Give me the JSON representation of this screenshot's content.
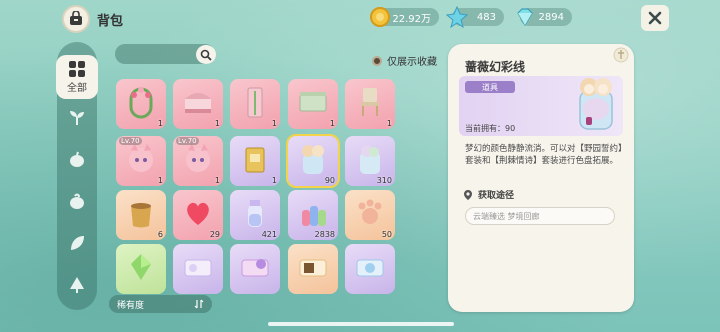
{
  "header": {
    "title": "背包"
  },
  "currencies": [
    {
      "icon": "gold-coin-icon",
      "value": "22.92万"
    },
    {
      "icon": "blue-star-gem-icon",
      "value": "483"
    },
    {
      "icon": "diamond-icon",
      "value": "2894"
    }
  ],
  "sidebar": {
    "active_label": "全部"
  },
  "filter": {
    "only_favorites_label": "仅展示收藏"
  },
  "sort": {
    "label": "稀有度",
    "icon": "sort-icon"
  },
  "items": [
    {
      "name": "flower-arch",
      "count": "1",
      "color": "pink",
      "lv": ""
    },
    {
      "name": "canopy-bed",
      "count": "1",
      "color": "pink",
      "lv": ""
    },
    {
      "name": "pink-door",
      "count": "1",
      "color": "pink",
      "lv": ""
    },
    {
      "name": "green-cabinet",
      "count": "1",
      "color": "pink",
      "lv": ""
    },
    {
      "name": "wooden-chair",
      "count": "1",
      "color": "pink",
      "lv": ""
    },
    {
      "name": "cat-face-lv70",
      "count": "1",
      "color": "pink",
      "lv": "Lv.70"
    },
    {
      "name": "cat-face-lv70-b",
      "count": "1",
      "color": "pink",
      "lv": "Lv.70"
    },
    {
      "name": "gold-book",
      "count": "1",
      "color": "purple",
      "lv": ""
    },
    {
      "name": "rose-yarn",
      "count": "90",
      "color": "purple",
      "lv": ""
    },
    {
      "name": "yarn-bag",
      "count": "310",
      "color": "purple",
      "lv": ""
    },
    {
      "name": "seed-sack",
      "count": "6",
      "color": "orange",
      "lv": ""
    },
    {
      "name": "red-heart",
      "count": "29",
      "color": "pink",
      "lv": ""
    },
    {
      "name": "potion-bottle",
      "count": "421",
      "color": "purple",
      "lv": ""
    },
    {
      "name": "dye-bottles",
      "count": "2838",
      "color": "purple",
      "lv": ""
    },
    {
      "name": "paw-cookie",
      "count": "50",
      "color": "orange",
      "lv": ""
    },
    {
      "name": "green-crystal",
      "count": "",
      "color": "green",
      "lv": ""
    },
    {
      "name": "ticket-a",
      "count": "",
      "color": "purple",
      "lv": ""
    },
    {
      "name": "ticket-b",
      "count": "",
      "color": "purple",
      "lv": ""
    },
    {
      "name": "ticket-c",
      "count": "",
      "color": "orange",
      "lv": ""
    },
    {
      "name": "ticket-d",
      "count": "",
      "color": "purple",
      "lv": ""
    }
  ],
  "detail": {
    "title": "蔷薇幻彩线",
    "type": "道具",
    "owned": "当前拥有：90",
    "description": "梦幻的颜色静静流淌。可以对【野园誓约】套装和【荆棘情诗】套装进行色盘拓展。",
    "source_title": "获取途径",
    "source_link": "云端臻选 梦境回廊"
  }
}
